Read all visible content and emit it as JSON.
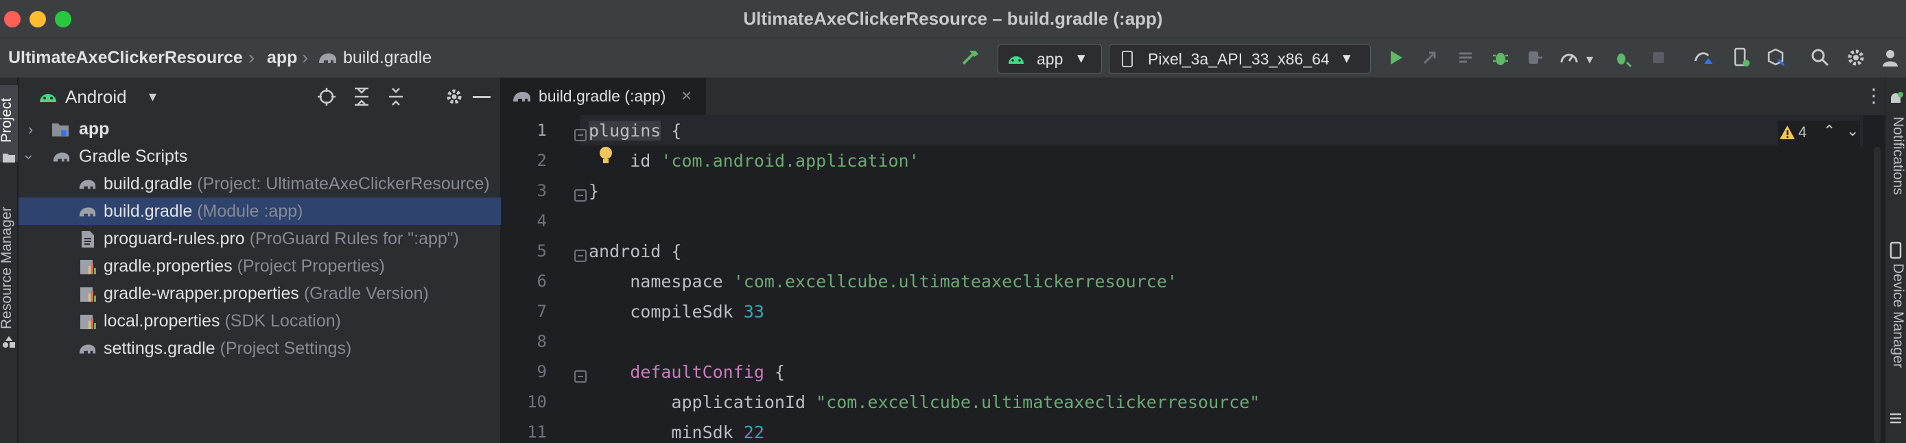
{
  "window": {
    "title": "UltimateAxeClickerResource – build.gradle (:app)"
  },
  "breadcrumb": {
    "project": "UltimateAxeClickerResource",
    "module": "app",
    "file": "build.gradle"
  },
  "toolbar": {
    "run_config": "app",
    "device": "Pixel_3a_API_33_x86_64"
  },
  "left_strip": {
    "project_tab": "Project",
    "resource_manager_tab": "Resource Manager"
  },
  "project_panel": {
    "view_selector": "Android",
    "tree": [
      {
        "label": "app",
        "hint": ""
      },
      {
        "label": "Gradle Scripts",
        "hint": ""
      },
      {
        "label": "build.gradle",
        "hint": " (Project: UltimateAxeClickerResource)"
      },
      {
        "label": "build.gradle",
        "hint": " (Module :app)"
      },
      {
        "label": "proguard-rules.pro",
        "hint": " (ProGuard Rules for \":app\")"
      },
      {
        "label": "gradle.properties",
        "hint": " (Project Properties)"
      },
      {
        "label": "gradle-wrapper.properties",
        "hint": " (Gradle Version)"
      },
      {
        "label": "local.properties",
        "hint": " (SDK Location)"
      },
      {
        "label": "settings.gradle",
        "hint": " (Project Settings)"
      }
    ]
  },
  "editor": {
    "tab_label": "build.gradle (:app)",
    "warnings_count": "4",
    "line_numbers": [
      "1",
      "2",
      "3",
      "4",
      "5",
      "6",
      "7",
      "8",
      "9",
      "10",
      "11"
    ],
    "lines": {
      "l1": "plugins",
      "l1_brace": " {",
      "l2_id": "id ",
      "l2_str": "'com.android.application'",
      "l3": "}",
      "l5": "android {",
      "l6_key": "namespace ",
      "l6_str": "'com.excellcube.ultimateaxeclickerresource'",
      "l7_key": "compileSdk ",
      "l7_num": "33",
      "l9_fn": "defaultConfig",
      "l9_brace": " {",
      "l10_key": "applicationId ",
      "l10_str": "\"com.excellcube.ultimateaxeclickerresource\"",
      "l11_key": "minSdk ",
      "l11_num": "22"
    }
  },
  "right_strip": {
    "notifications_tab": "Notifications",
    "device_manager_tab": "Device Manager"
  },
  "colors": {
    "accent": "#3574f0",
    "selection": "#2e436e",
    "string": "#6aab73",
    "number": "#2aacb8",
    "keyword_fn": "#c77dbb",
    "android_green": "#3ddc84"
  }
}
